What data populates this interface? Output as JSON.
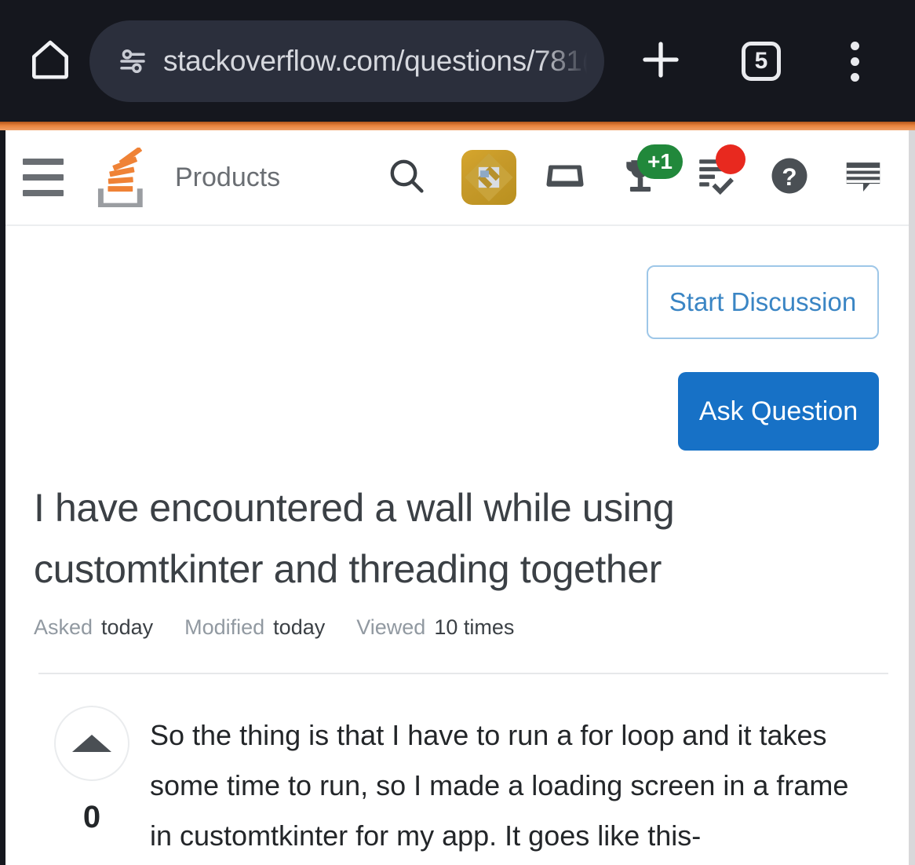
{
  "browser": {
    "home_icon": "home-icon",
    "site_settings_icon": "tune-icon",
    "url": "stackoverflow.com/questions/781(",
    "new_tab_icon": "plus-icon",
    "tab_count": "5",
    "menu_icon": "kebab-menu-icon",
    "accent_strip_color": "#e8833c",
    "bar_background": "#15171e"
  },
  "site_nav": {
    "hamburger_icon": "hamburger-icon",
    "logo_icon": "stackoverflow-logo-icon",
    "products_label": "Products",
    "search_icon": "search-icon",
    "avatar_icon": "user-avatar-icon",
    "inbox_icon": "inbox-icon",
    "achievements_icon": "trophy-icon",
    "achievements_badge": "+1",
    "review_icon": "review-queue-icon",
    "review_badge_color": "#e8291f",
    "help_icon": "help-circle-icon",
    "chat_icon": "stack-exchange-chat-icon",
    "badge_green": "#21883b"
  },
  "actions": {
    "start_discussion_label": "Start Discussion",
    "ask_question_label": "Ask Question",
    "primary_color": "#1771c6",
    "outline_color": "#9ec7e8"
  },
  "question": {
    "title": "I have encountered a wall while using customtkinter and threading together",
    "meta": [
      {
        "label": "Asked",
        "value": "today"
      },
      {
        "label": "Modified",
        "value": "today"
      },
      {
        "label": "Viewed",
        "value": "10 times"
      }
    ],
    "vote_count": "0",
    "upvote_icon": "upvote-arrow-icon",
    "body": "So the thing is that I have to run a for loop and it takes some time to run, so I made a loading screen in a frame in customtkinter for my app. It goes like this-"
  }
}
